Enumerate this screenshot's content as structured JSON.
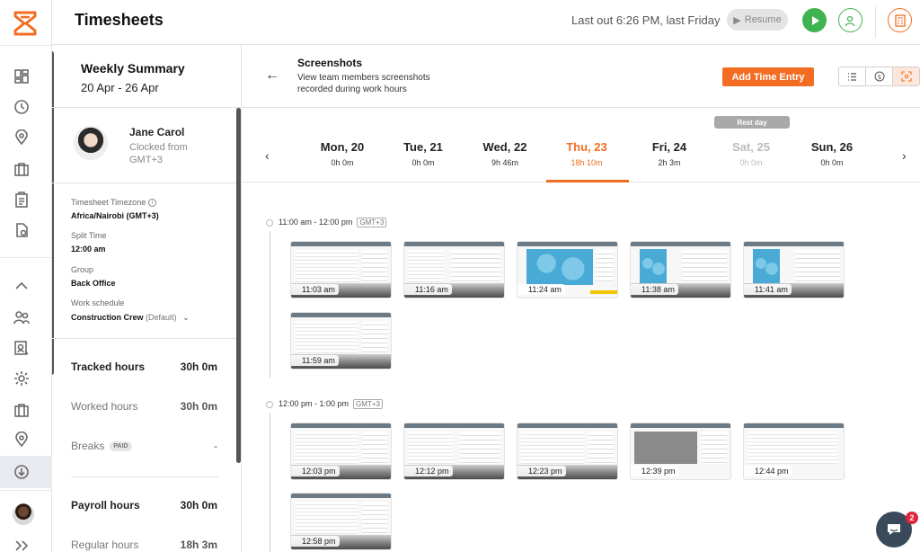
{
  "app": {
    "title": "Timesheets"
  },
  "header": {
    "last_out": "Last out 6:26 PM, last Friday",
    "resume_label": "Resume"
  },
  "rail": {
    "icons": [
      "dashboard-icon",
      "clock-icon",
      "location-icon",
      "briefcase-icon",
      "clipboard-icon",
      "report-icon",
      "chevron-up-icon",
      "users-icon",
      "screenshots-icon",
      "settings-icon",
      "projects-icon",
      "pin-icon",
      "download-icon",
      "profile-avatar",
      "expand-icon"
    ]
  },
  "summary": {
    "title": "Weekly Summary",
    "range": "20 Apr - 26 Apr",
    "employee": {
      "name": "Jane Carol",
      "status": "Clocked from GMT+3"
    },
    "timezone_label": "Timesheet Timezone",
    "timezone_value": "Africa/Nairobi (GMT+3)",
    "split_label": "Split Time",
    "split_value": "12:00 am",
    "group_label": "Group",
    "group_value": "Back Office",
    "schedule_label": "Work schedule",
    "schedule_value": "Construction Crew",
    "schedule_default": "(Default)",
    "tracked_label": "Tracked hours",
    "tracked_value": "30h 0m",
    "worked_label": "Worked hours",
    "worked_value": "30h 0m",
    "breaks_label": "Breaks",
    "breaks_badge": "PAID",
    "breaks_value": "-",
    "payroll_label": "Payroll hours",
    "payroll_value": "30h 0m",
    "regular_label": "Regular hours",
    "regular_value": "18h 3m"
  },
  "main": {
    "title": "Screenshots",
    "description": "View team members screenshots recorded during work hours",
    "add_entry_label": "Add Time Entry",
    "rest_day_label": "Rest day",
    "days": [
      {
        "name": "Mon, 20",
        "hours": "0h 0m"
      },
      {
        "name": "Tue, 21",
        "hours": "0h 0m"
      },
      {
        "name": "Wed, 22",
        "hours": "9h 46m"
      },
      {
        "name": "Thu, 23",
        "hours": "18h 10m"
      },
      {
        "name": "Fri, 24",
        "hours": "2h 3m"
      },
      {
        "name": "Sat, 25",
        "hours": "0h 0m"
      },
      {
        "name": "Sun, 26",
        "hours": "0h 0m"
      }
    ],
    "active_day": "Thu, 23",
    "slots": [
      {
        "range": "11:00 am - 12:00 pm",
        "tz": "GMT+3",
        "shots": [
          "11:03 am",
          "11:16 am",
          "11:24 am",
          "11:38 am",
          "11:41 am",
          "11:59 am"
        ]
      },
      {
        "range": "12:00 pm - 1:00 pm",
        "tz": "GMT+3",
        "shots": [
          "12:03 pm",
          "12:12 pm",
          "12:23 pm",
          "12:39 pm",
          "12:44 pm",
          "12:58 pm"
        ]
      }
    ]
  },
  "chat": {
    "badge": "2"
  },
  "colors": {
    "accent": "#f26d21",
    "green": "#3fb34f"
  }
}
